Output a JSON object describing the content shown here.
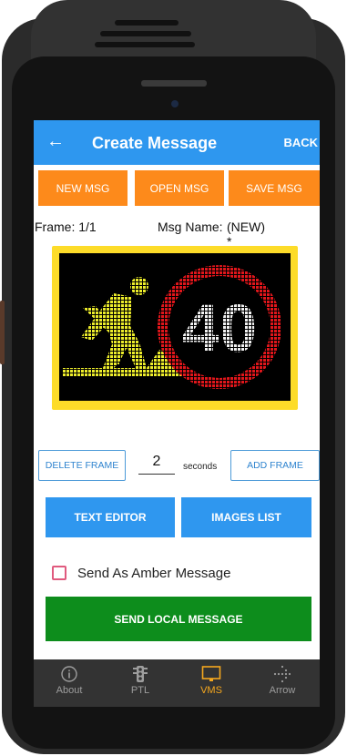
{
  "appbar": {
    "back_icon": "arrow-left-icon",
    "title": "Create Message",
    "back_label": "BACK"
  },
  "actions": {
    "new_msg": "NEW MSG",
    "open_msg": "OPEN MSG",
    "save_msg": "SAVE MSG"
  },
  "frame_info": {
    "frame_label": "Frame: 1/1",
    "msg_name_label": "Msg Name:",
    "msg_name_value": "(NEW)\n*"
  },
  "sign": {
    "speed_limit": "40",
    "image": "roadworks-pictogram",
    "border_color": "#fddc29",
    "ring_color": "#e0161b",
    "figure_color": "#ecec2b"
  },
  "frame_controls": {
    "delete_frame": "DELETE FRAME",
    "seconds_value": "2",
    "seconds_label": "seconds",
    "add_frame": "ADD FRAME"
  },
  "editors": {
    "text_editor": "TEXT EDITOR",
    "images_list": "IMAGES LIST"
  },
  "amber": {
    "label": "Send As Amber Message",
    "checked": false
  },
  "send_button": "SEND LOCAL MESSAGE",
  "bottom_nav": [
    {
      "label": "About",
      "icon": "info-icon",
      "active": false
    },
    {
      "label": "PTL",
      "icon": "traffic-light-icon",
      "active": false
    },
    {
      "label": "VMS",
      "icon": "monitor-icon",
      "active": true
    },
    {
      "label": "Arrow",
      "icon": "arrow-dots-icon",
      "active": false
    }
  ]
}
